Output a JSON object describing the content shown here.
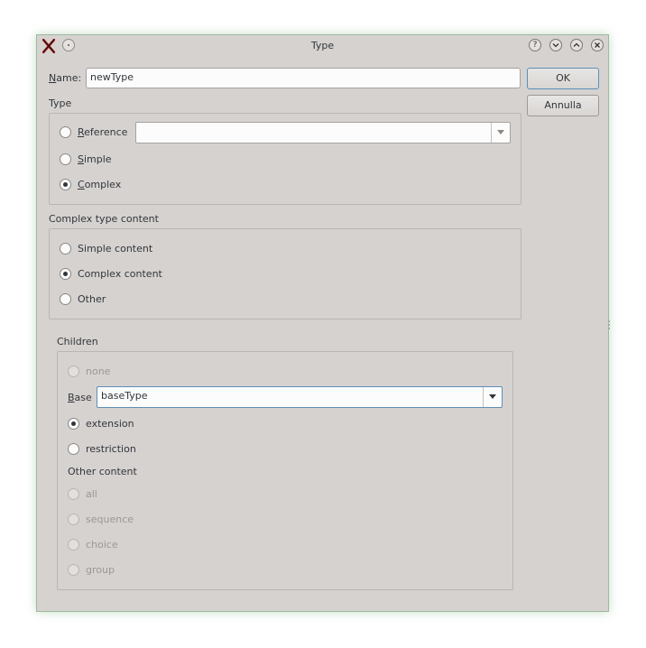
{
  "window": {
    "title": "Type"
  },
  "name_field": {
    "label_first": "N",
    "label_rest": "ame:",
    "value": "newType"
  },
  "buttons": {
    "ok": "OK",
    "cancel": "Annulla"
  },
  "type_group": {
    "title": "Type",
    "reference": {
      "first": "R",
      "rest": "eference",
      "checked": false
    },
    "simple": {
      "first": "S",
      "rest": "imple",
      "checked": false
    },
    "complex": {
      "first": "C",
      "rest": "omplex",
      "checked": true
    },
    "reference_combo_value": ""
  },
  "complex_content_group": {
    "title": "Complex type content",
    "options": [
      {
        "label": "Simple content",
        "checked": false
      },
      {
        "label": "Complex content",
        "checked": true
      },
      {
        "label": "Other",
        "checked": false
      }
    ]
  },
  "children_group": {
    "title": "Children",
    "none_label": "none",
    "base_label_first": "B",
    "base_label_rest": "ase",
    "base_value": "baseType",
    "extension_label": "extension",
    "restriction_label": "restriction",
    "other_content_title": "Other content",
    "other_options": [
      "all",
      "sequence",
      "choice",
      "group"
    ]
  },
  "titlebar_icons": [
    "close-x-icon",
    "menu-dot-icon",
    "help-icon",
    "minimize-icon",
    "maximize-icon",
    "close-icon"
  ]
}
